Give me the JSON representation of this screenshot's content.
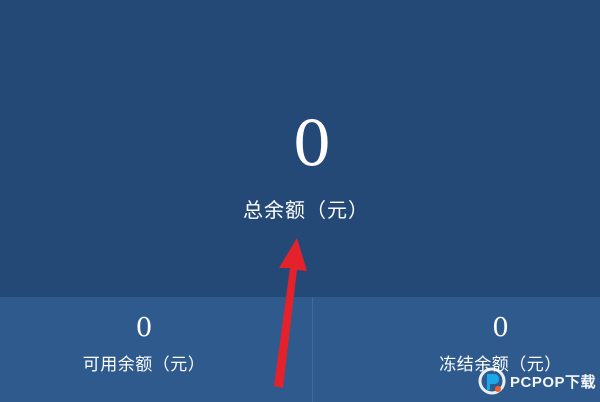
{
  "balance": {
    "total_value": "0",
    "total_label": "总余额（元）",
    "available_value": "0",
    "available_label": "可用余额（元）",
    "frozen_value": "0",
    "frozen_label": "冻结余额（元）"
  },
  "watermark": {
    "text": "PCPOP下载"
  },
  "colors": {
    "top_panel": "#244977",
    "bottom_panel": "#2e5a8e",
    "arrow": "#e3222b",
    "text": "#ffffff"
  },
  "icons": {
    "annotation": "red-arrow-icon",
    "watermark_logo": "pcpop-logo-icon"
  }
}
